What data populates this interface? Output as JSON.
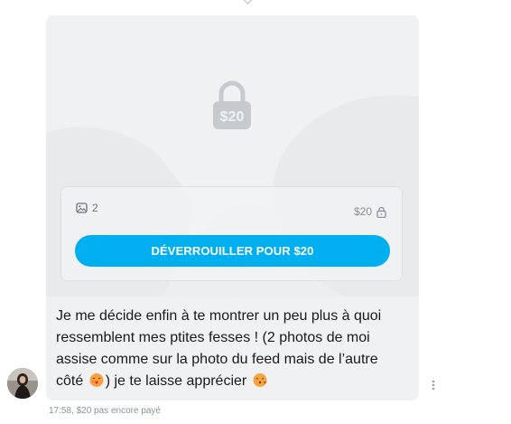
{
  "post": {
    "media_count": "2",
    "price_small": "$20",
    "lock_price": "$20",
    "unlock_label": "DÉVERROUILLER POUR $20",
    "message_line1": "Je me décide enfin à te montrer un peu plus à quoi",
    "message_line2": "ressemblent mes ptites fesses ! (2 photos de moi",
    "message_line3": "assise comme sur la photo du feed mais de l’autre",
    "message_line4_a": "côté",
    "message_line4_b": ") je te laisse apprécier",
    "emoji_1": "kissing-face-with-heart-emoji",
    "emoji_2": "face-blowing-kiss-emoji"
  },
  "meta": {
    "time": "17:58,",
    "price_status": "$20 pas encore payé"
  },
  "colors": {
    "accent": "#00aff0",
    "bubble_bg": "#f0f1f3",
    "muted": "#8a9299"
  },
  "icons": [
    "chevron-icon",
    "lock-icon",
    "image-icon",
    "small-lock-icon",
    "more-vertical-icon",
    "avatar"
  ]
}
